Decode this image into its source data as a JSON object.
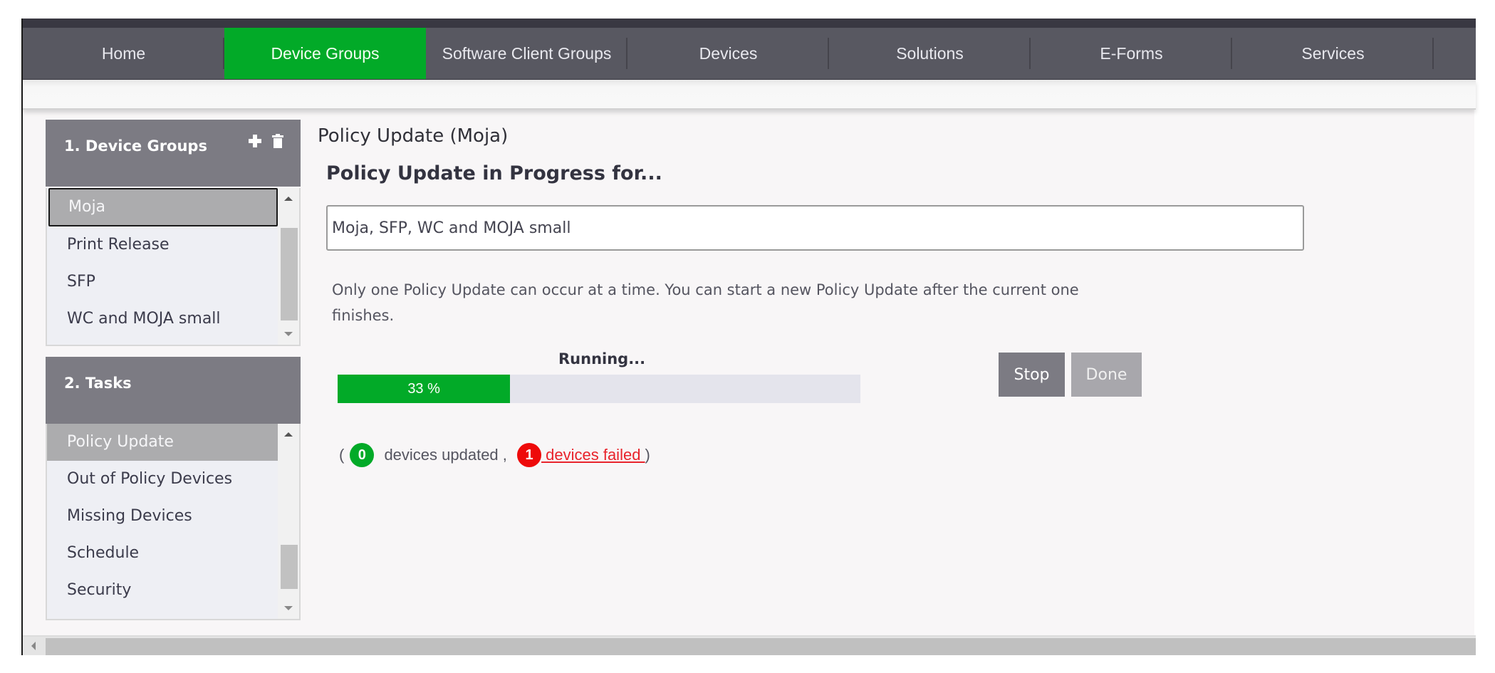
{
  "nav": {
    "items": [
      {
        "label": "Home",
        "active": false
      },
      {
        "label": "Device Groups",
        "active": true
      },
      {
        "label": "Software Client Groups",
        "active": false
      },
      {
        "label": "Devices",
        "active": false
      },
      {
        "label": "Solutions",
        "active": false
      },
      {
        "label": "E-Forms",
        "active": false
      },
      {
        "label": "Services",
        "active": false
      }
    ]
  },
  "device_groups_panel": {
    "title": "1. Device Groups",
    "add_icon": "plus-icon",
    "delete_icon": "trash-icon",
    "items": [
      "Moja",
      "Print Release",
      "SFP",
      "WC and MOJA small"
    ],
    "selected": "Moja"
  },
  "tasks_panel": {
    "title": "2. Tasks",
    "items": [
      "Policy Update",
      "Out of Policy Devices",
      "Missing Devices",
      "Schedule",
      "Security"
    ],
    "selected": "Policy Update"
  },
  "main": {
    "page_title": "Policy Update (Moja)",
    "section_title": "Policy Update in Progress for...",
    "groups_value": "Moja, SFP, WC and MOJA small",
    "info_text": "Only one Policy Update can occur at a time. You can start a new Policy Update after the current one finishes.",
    "status_label": "Running...",
    "progress_percent": 33,
    "progress_text": "33 %",
    "stop_label": "Stop",
    "done_label": "Done",
    "open_paren": "(",
    "updated_count": "0",
    "updated_text": " devices updated , ",
    "failed_count": "1",
    "failed_text": " devices failed ",
    "close_paren": ")"
  },
  "colors": {
    "accent_green": "#02aa28",
    "nav_bg": "#585861",
    "panel_header": "#7c7b83",
    "failed_red": "#ee0a0a"
  }
}
